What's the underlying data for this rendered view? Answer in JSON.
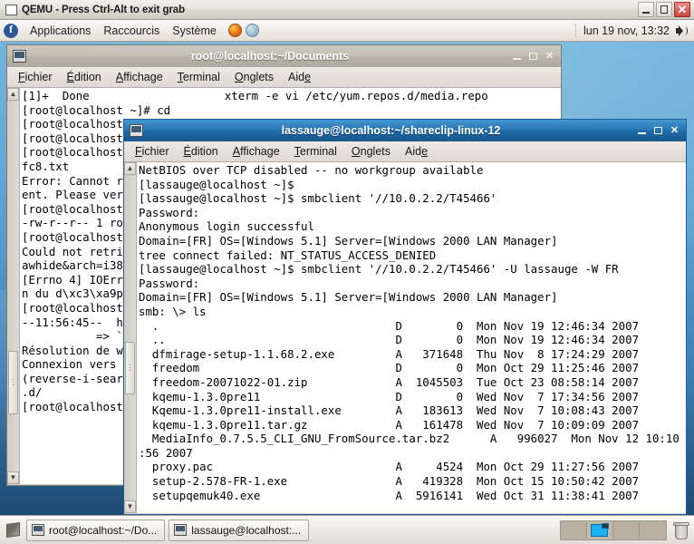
{
  "qemu_window": {
    "title": "QEMU - Press Ctrl-Alt to exit grab",
    "icon": "monitor-icon",
    "minimize_label": "",
    "maximize_label": "",
    "close_label": "✕"
  },
  "top_panel": {
    "logo": "fedora-logo",
    "menus": [
      "Applications",
      "Raccourcis",
      "Système"
    ],
    "launchers": [
      "firefox-icon",
      "help-icon"
    ],
    "clock": "lun 19 nov, 13:32",
    "volume_icon": "speaker-icon"
  },
  "window_bg": {
    "title": "root@localhost:~/Documents",
    "menus": [
      "Fichier",
      "Édition",
      "Affichage",
      "Terminal",
      "Onglets",
      "Aide"
    ],
    "menu_mnemonics": [
      "F",
      "E",
      "A",
      "T",
      "O",
      "e"
    ],
    "buttons": {
      "minimize": "_",
      "maximize": "□",
      "close": "✕"
    },
    "terminal_lines": [
      "[1]+  Done                    xterm -e vi /etc/yum.repos.d/media.repo",
      "[root@localhost ~]# cd",
      "[root@localhost ~]# mkdir Documents",
      "[root@localhost ~]# cd Documents",
      "[root@localhost Documents]# wget http://",
      "fc8.txt",
      "Error: Cannot retrieve repository metadata (repomd.xml) for repository: developm",
      "ent. Please verify its path and try again",
      "[root@localhost Documents]# ls -l",
      "-rw-r--r-- 1 root root  4096 nov 19 11:56 fc8.txt",
      "[root@localhost Documents]# yum update",
      "Could not retrieve mirrorlist http://mirrors.fedoraproject.org/mirrorlist?repo=r",
      "awhide&arch=i386 error was",
      "[Errno 4] IOError: <urlopen error (-2, 'Nom ou service inconnu')>",
      "n du d\\xc3\\xa9p\\xc3\\xb4t",
      "[root@localhost Documents]# wget http://",
      "--11:56:45--  http://download.fedora.redhat.com/",
      "           => `fc8.txt'",
      "Résolution de www.download.fedora.redhat.com...",
      "Connexion vers www.download.fedora.redhat.com|209.132.176.20|:80...",
      "(reverse-i-search)`yum': ls /etc/yum.repos",
      ".d/",
      "[root@localhost Documents]#"
    ]
  },
  "window_fg": {
    "title": "lassauge@localhost:~/shareclip-linux-12",
    "menus": [
      "Fichier",
      "Édition",
      "Affichage",
      "Terminal",
      "Onglets",
      "Aide"
    ],
    "menu_mnemonics": [
      "F",
      "E",
      "A",
      "T",
      "O",
      "e"
    ],
    "buttons": {
      "minimize": "_",
      "maximize": "□",
      "close": "✕"
    },
    "terminal_lines": [
      "NetBIOS over TCP disabled -- no workgroup available",
      "[lassauge@localhost ~]$",
      "[lassauge@localhost ~]$ smbclient '//10.0.2.2/T45466'",
      "Password:",
      "Anonymous login successful",
      "Domain=[FR] OS=[Windows 5.1] Server=[Windows 2000 LAN Manager]",
      "tree connect failed: NT_STATUS_ACCESS_DENIED",
      "[lassauge@localhost ~]$ smbclient '//10.0.2.2/T45466' -U lassauge -W FR",
      "Password:",
      "Domain=[FR] OS=[Windows 5.1] Server=[Windows 2000 LAN Manager]",
      "smb: \\> ls",
      "  .                                   D        0  Mon Nov 19 12:46:34 2007",
      "  ..                                  D        0  Mon Nov 19 12:46:34 2007",
      "  dfmirage-setup-1.1.68.2.exe         A   371648  Thu Nov  8 17:24:29 2007",
      "  freedom                             D        0  Mon Oct 29 11:25:46 2007",
      "  freedom-20071022-01.zip             A  1045503  Tue Oct 23 08:58:14 2007",
      "  kqemu-1.3.0pre11                    D        0  Wed Nov  7 17:34:56 2007",
      "  Kqemu-1.3.0pre11-install.exe        A   183613  Wed Nov  7 10:08:43 2007",
      "  kqemu-1.3.0pre11.tar.gz             A   161478  Wed Nov  7 10:09:09 2007",
      "  MediaInfo_0.7.5.5_CLI_GNU_FromSource.tar.bz2      A   996027  Mon Nov 12 10:10",
      ":56 2007",
      "  proxy.pac                           A     4524  Mon Oct 29 11:27:56 2007",
      "  setup-2.578-FR-1.exe                A   419328  Mon Oct 15 10:50:42 2007",
      "  setupqemuk40.exe                    A  5916141  Wed Oct 31 11:38:41 2007"
    ]
  },
  "taskbar": {
    "show_desktop": "show-desktop-icon",
    "tasks": [
      {
        "icon": "terminal-icon",
        "label": "root@localhost:~/Do..."
      },
      {
        "icon": "terminal-icon",
        "label": "lassauge@localhost:..."
      }
    ],
    "workspaces": 4,
    "active_workspace": 2,
    "trash": "trash-icon"
  },
  "colors": {
    "active_title": "#1f6aa8",
    "inactive_title": "#b9b4a9",
    "desktop_top": "#73b4dd",
    "desktop_bottom": "#1d4a73",
    "panel_bg": "#efece7"
  }
}
